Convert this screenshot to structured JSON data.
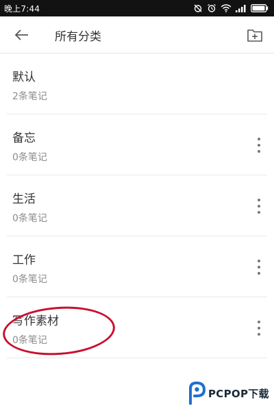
{
  "status_bar": {
    "time": "晚上7:44",
    "icons": [
      "alarm-off-icon",
      "alarm-icon",
      "wifi-icon",
      "signal-icon",
      "battery-icon"
    ]
  },
  "header": {
    "title": "所有分类",
    "back_icon": "back-arrow-icon",
    "action_icon": "add-folder-icon"
  },
  "categories": [
    {
      "name": "默认",
      "count": "2条笔记",
      "has_more": false
    },
    {
      "name": "备忘",
      "count": "0条笔记",
      "has_more": true
    },
    {
      "name": "生活",
      "count": "0条笔记",
      "has_more": true
    },
    {
      "name": "工作",
      "count": "0条笔记",
      "has_more": true
    },
    {
      "name": "写作素材",
      "count": "0条笔记",
      "has_more": true
    }
  ],
  "annotation": {
    "color": "#c8102e"
  },
  "watermark": {
    "text": "PCPOP下载"
  }
}
